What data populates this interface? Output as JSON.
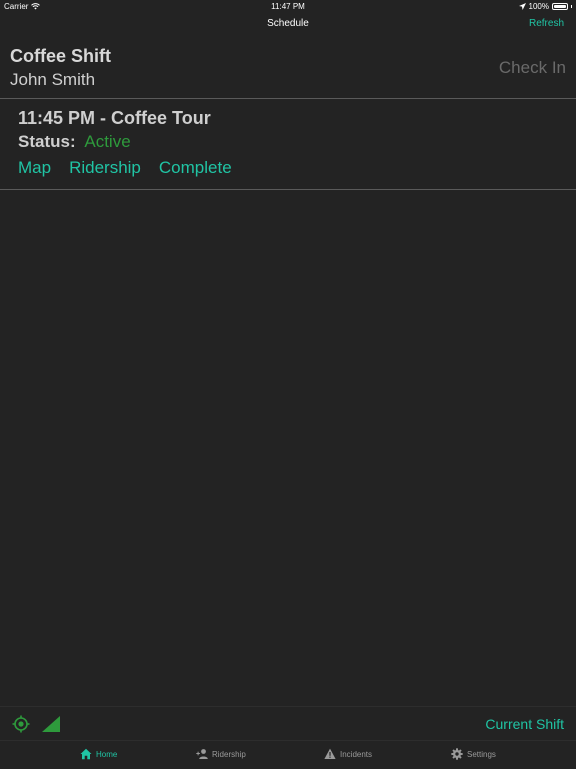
{
  "status_bar": {
    "carrier": "Carrier",
    "time": "11:47 PM",
    "battery": "100%"
  },
  "nav": {
    "title": "Schedule",
    "refresh_label": "Refresh"
  },
  "shift": {
    "title": "Coffee Shift",
    "user": "John Smith",
    "check_in_label": "Check In"
  },
  "trip": {
    "title": "11:45 PM - Coffee Tour",
    "status_label": "Status:",
    "status_value": "Active",
    "actions": {
      "map": "Map",
      "ridership": "Ridership",
      "complete": "Complete"
    }
  },
  "bottom": {
    "current_shift_label": "Current Shift",
    "location_icon": "location-target-icon",
    "signal_icon": "signal-strength-icon"
  },
  "tabs": [
    {
      "label": "Home",
      "icon": "home-icon",
      "active": true
    },
    {
      "label": "Ridership",
      "icon": "add-person-icon",
      "active": false
    },
    {
      "label": "Incidents",
      "icon": "warning-icon",
      "active": false
    },
    {
      "label": "Settings",
      "icon": "gear-icon",
      "active": false
    }
  ],
  "colors": {
    "accent": "#20c4a4",
    "status_active": "#2e9a3c",
    "background": "#232323"
  }
}
